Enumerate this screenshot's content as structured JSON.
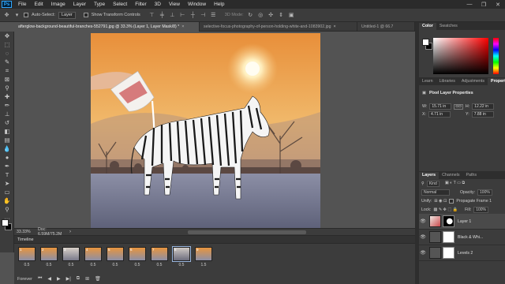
{
  "menubar": {
    "logo": "Ps",
    "items": [
      "File",
      "Edit",
      "Image",
      "Layer",
      "Type",
      "Select",
      "Filter",
      "3D",
      "View",
      "Window",
      "Help"
    ],
    "window_controls": [
      "—",
      "❐",
      "✕"
    ]
  },
  "options": {
    "auto_select_label": "Auto-Select:",
    "auto_select_value": "Layer",
    "transform_label": "Show Transform Controls",
    "three_d_mode": "3D Mode:"
  },
  "tabs": [
    {
      "label": "afterglow-background-beautiful-branches-552791.jpg @ 33.3% (Layer 1, Layer Mask/8) *",
      "active": true
    },
    {
      "label": "selective-focus-photography-of-person-holding-white-and-1083902.jpg",
      "active": false
    },
    {
      "label": "Untitled-1 @ 66.7",
      "active": false
    }
  ],
  "status": {
    "zoom": "33.33%",
    "doc": "Doc: 6.59M/75.2M"
  },
  "timeline": {
    "title": "Timeline",
    "frames": [
      {
        "num": "1",
        "delay": "0.5"
      },
      {
        "num": "2",
        "delay": "0.5"
      },
      {
        "num": "3",
        "delay": "0.5"
      },
      {
        "num": "4",
        "delay": "0.5"
      },
      {
        "num": "5",
        "delay": "0.5"
      },
      {
        "num": "6",
        "delay": "0.5"
      },
      {
        "num": "7",
        "delay": "0.5"
      },
      {
        "num": "8",
        "delay": "0.5"
      },
      {
        "num": "9",
        "delay": "1.5"
      }
    ],
    "loop": "Forever"
  },
  "panels": {
    "color_tabs": [
      "Color",
      "Swatches"
    ],
    "props_tabs": [
      "Learn",
      "Libraries",
      "Adjustments",
      "Properties"
    ],
    "props_title": "Pixel Layer Properties",
    "W": "15.71 in",
    "H": "12.22 in",
    "X": "4.71 in",
    "Y": "7.88 in",
    "go_label": "GO",
    "layers_tabs": [
      "Layers",
      "Channels",
      "Paths"
    ],
    "kind": "Kind",
    "blend_mode": "Normal",
    "opacity_label": "Opacity:",
    "opacity": "100%",
    "unify_label": "Unify:",
    "propagate_label": "Propagate Frame 1",
    "lock_label": "Lock:",
    "fill_label": "Fill:",
    "fill": "100%",
    "layers": [
      {
        "name": "Layer 1",
        "active": true
      },
      {
        "name": "Black & Whi...",
        "active": false
      },
      {
        "name": "Levels 2",
        "active": false
      }
    ]
  }
}
